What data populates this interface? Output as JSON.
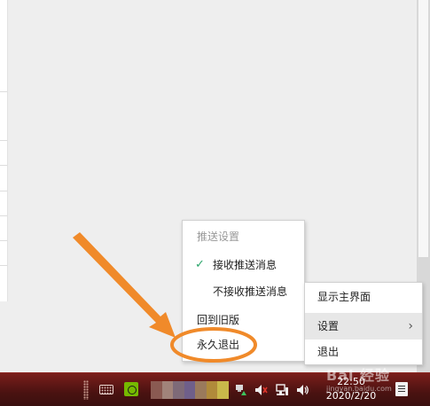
{
  "push_menu": {
    "header": "推送设置",
    "receive": "接收推送消息",
    "no_receive": "不接收推送消息",
    "back_old": "回到旧版",
    "quit_forever": "永久退出"
  },
  "main_menu": {
    "show_main": "显示主界面",
    "settings": "设置",
    "quit": "退出"
  },
  "taskbar": {
    "time": "22:50",
    "date": "2020/2/20"
  },
  "watermark": {
    "title": "Bai 经验",
    "url": "jingyan.baidu.com"
  },
  "colors": {
    "annotation": "#f08a2a",
    "check": "#2aa56a",
    "taskbar": "#5a1614"
  },
  "icons": [
    "check-icon",
    "chevron-right-icon",
    "keyboard-icon",
    "nvidia-icon",
    "network-warning-icon",
    "volume-muted-icon",
    "network-icon",
    "volume-icon",
    "notification-icon"
  ]
}
